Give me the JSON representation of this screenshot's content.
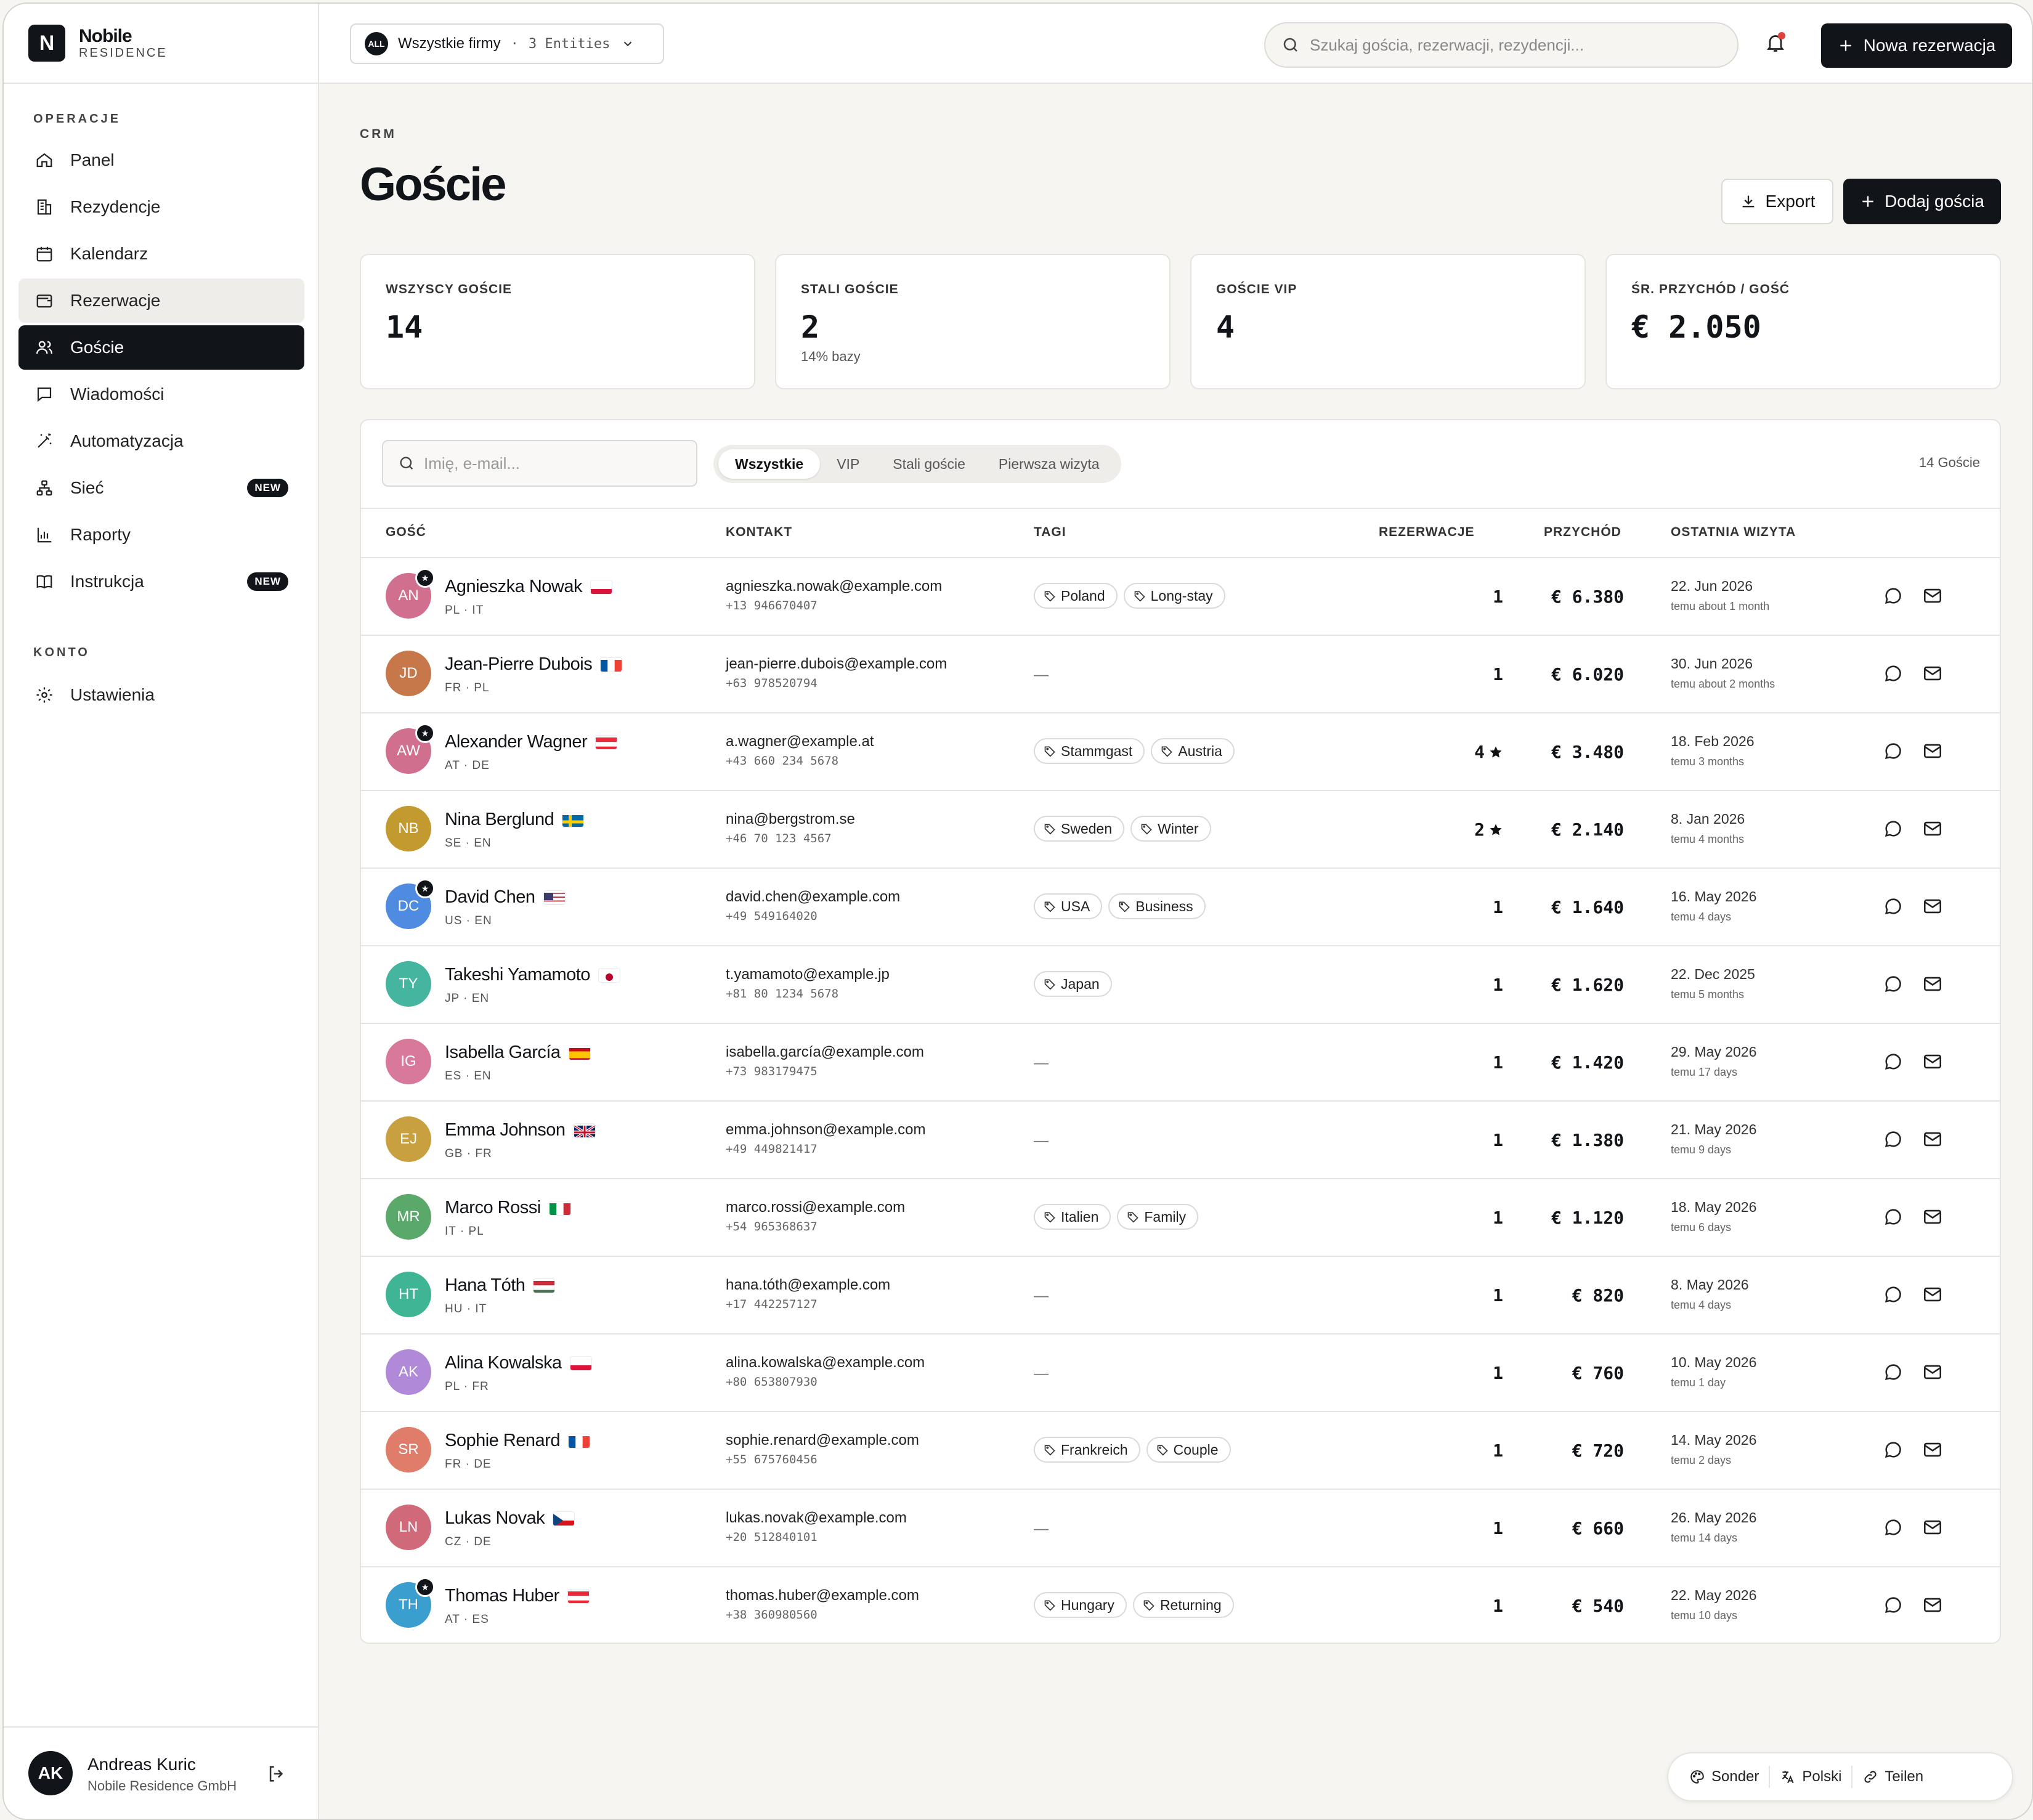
{
  "brand": {
    "logo_letter": "N",
    "name": "Nobile",
    "sub": "RESIDENCE"
  },
  "sidebar": {
    "section_ops": "OPERACJE",
    "items": [
      {
        "label": "Panel",
        "icon": "home-icon"
      },
      {
        "label": "Rezydencje",
        "icon": "building-icon"
      },
      {
        "label": "Kalendarz",
        "icon": "calendar-icon"
      },
      {
        "label": "Rezerwacje",
        "icon": "wallet-icon"
      },
      {
        "label": "Goście",
        "icon": "users-icon"
      },
      {
        "label": "Wiadomości",
        "icon": "message-icon"
      },
      {
        "label": "Automatyzacja",
        "icon": "wand-icon"
      },
      {
        "label": "Sieć",
        "icon": "network-icon",
        "badge": "NEW"
      },
      {
        "label": "Raporty",
        "icon": "chart-icon"
      },
      {
        "label": "Instrukcja",
        "icon": "book-icon",
        "badge": "NEW"
      }
    ],
    "section_account": "KONTO",
    "settings_label": "Ustawienia",
    "user": {
      "initials": "AK",
      "name": "Andreas Kuric",
      "org": "Nobile Residence GmbH"
    }
  },
  "topbar": {
    "entity_badge": "ALL",
    "entity_label": "Wszystkie firmy",
    "entity_sep": "·",
    "entity_count": "3 Entities",
    "search_placeholder": "Szukaj gościa, rezerwacji, rezydencji...",
    "new_booking": "Nowa rezerwacja"
  },
  "page": {
    "crumb": "CRM",
    "title": "Goście",
    "export": "Export",
    "add_guest": "Dodaj gościa"
  },
  "stats": [
    {
      "label": "WSZYSCY GOŚCIE",
      "value": "14",
      "sub": ""
    },
    {
      "label": "STALI GOŚCIE",
      "value": "2",
      "sub": "14% bazy"
    },
    {
      "label": "GOŚCIE VIP",
      "value": "4",
      "sub": ""
    },
    {
      "label": "ŚR. PRZYCHÓD / GOŚĆ",
      "value": "€ 2.050",
      "sub": ""
    }
  ],
  "filters": {
    "search_placeholder": "Imię, e-mail...",
    "segments": [
      "Wszystkie",
      "VIP",
      "Stali goście",
      "Pierwsza wizyta"
    ],
    "active_segment": "Wszystkie",
    "count": "14 Goście"
  },
  "table": {
    "headers": [
      "GOŚĆ",
      "KONTAKT",
      "TAGI",
      "REZERWACJE",
      "PRZYCHÓD",
      "OSTATNIA WIZYTA"
    ],
    "rows": [
      {
        "initials": "AN",
        "color": "#d0708e",
        "vip": true,
        "name": "Agnieszka Nowak",
        "flag": "pl",
        "langs": "PL · IT",
        "email": "agnieszka.nowak@example.com",
        "phone": "+13 946670407",
        "tags": [
          "Poland",
          "Long-stay"
        ],
        "res": "1",
        "star": false,
        "rev": "€ 6.380",
        "date": "22. Jun 2026",
        "rel": "temu about 1 month"
      },
      {
        "initials": "JD",
        "color": "#c7784a",
        "vip": false,
        "name": "Jean-Pierre Dubois",
        "flag": "fr",
        "langs": "FR · PL",
        "email": "jean-pierre.dubois@example.com",
        "phone": "+63 978520794",
        "tags": [],
        "res": "1",
        "star": false,
        "rev": "€ 6.020",
        "date": "30. Jun 2026",
        "rel": "temu about 2 months"
      },
      {
        "initials": "AW",
        "color": "#d0708e",
        "vip": true,
        "name": "Alexander Wagner",
        "flag": "at",
        "langs": "AT · DE",
        "email": "a.wagner@example.at",
        "phone": "+43 660 234 5678",
        "tags": [
          "Stammgast",
          "Austria"
        ],
        "res": "4",
        "star": true,
        "rev": "€ 3.480",
        "date": "18. Feb 2026",
        "rel": "temu 3 months"
      },
      {
        "initials": "NB",
        "color": "#c29a2f",
        "vip": false,
        "name": "Nina Berglund",
        "flag": "se",
        "langs": "SE · EN",
        "email": "nina@bergstrom.se",
        "phone": "+46 70 123 4567",
        "tags": [
          "Sweden",
          "Winter"
        ],
        "res": "2",
        "star": true,
        "rev": "€ 2.140",
        "date": "8. Jan 2026",
        "rel": "temu 4 months"
      },
      {
        "initials": "DC",
        "color": "#4f8be0",
        "vip": true,
        "name": "David Chen",
        "flag": "us",
        "langs": "US · EN",
        "email": "david.chen@example.com",
        "phone": "+49 549164020",
        "tags": [
          "USA",
          "Business"
        ],
        "res": "1",
        "star": false,
        "rev": "€ 1.640",
        "date": "16. May 2026",
        "rel": "temu 4 days"
      },
      {
        "initials": "TY",
        "color": "#45b5a0",
        "vip": false,
        "name": "Takeshi Yamamoto",
        "flag": "jp",
        "langs": "JP · EN",
        "email": "t.yamamoto@example.jp",
        "phone": "+81 80 1234 5678",
        "tags": [
          "Japan"
        ],
        "res": "1",
        "star": false,
        "rev": "€ 1.620",
        "date": "22. Dec 2025",
        "rel": "temu 5 months"
      },
      {
        "initials": "IG",
        "color": "#d8789a",
        "vip": false,
        "name": "Isabella García",
        "flag": "es",
        "langs": "ES · EN",
        "email": "isabella.garcía@example.com",
        "phone": "+73 983179475",
        "tags": [],
        "res": "1",
        "star": false,
        "rev": "€ 1.420",
        "date": "29. May 2026",
        "rel": "temu 17 days"
      },
      {
        "initials": "EJ",
        "color": "#c8a040",
        "vip": false,
        "name": "Emma Johnson",
        "flag": "gb",
        "langs": "GB · FR",
        "email": "emma.johnson@example.com",
        "phone": "+49 449821417",
        "tags": [],
        "res": "1",
        "star": false,
        "rev": "€ 1.380",
        "date": "21. May 2026",
        "rel": "temu 9 days"
      },
      {
        "initials": "MR",
        "color": "#5aa86a",
        "vip": false,
        "name": "Marco Rossi",
        "flag": "it",
        "langs": "IT · PL",
        "email": "marco.rossi@example.com",
        "phone": "+54 965368637",
        "tags": [
          "Italien",
          "Family"
        ],
        "res": "1",
        "star": false,
        "rev": "€ 1.120",
        "date": "18. May 2026",
        "rel": "temu 6 days"
      },
      {
        "initials": "HT",
        "color": "#3fb596",
        "vip": false,
        "name": "Hana Tóth",
        "flag": "hu",
        "langs": "HU · IT",
        "email": "hana.tóth@example.com",
        "phone": "+17 442257127",
        "tags": [],
        "res": "1",
        "star": false,
        "rev": "€ 820",
        "date": "8. May 2026",
        "rel": "temu 4 days"
      },
      {
        "initials": "AK",
        "color": "#b08ad8",
        "vip": false,
        "name": "Alina Kowalska",
        "flag": "pl",
        "langs": "PL · FR",
        "email": "alina.kowalska@example.com",
        "phone": "+80 653807930",
        "tags": [],
        "res": "1",
        "star": false,
        "rev": "€ 760",
        "date": "10. May 2026",
        "rel": "temu 1 day"
      },
      {
        "initials": "SR",
        "color": "#e07d6a",
        "vip": false,
        "name": "Sophie Renard",
        "flag": "fr",
        "langs": "FR · DE",
        "email": "sophie.renard@example.com",
        "phone": "+55 675760456",
        "tags": [
          "Frankreich",
          "Couple"
        ],
        "res": "1",
        "star": false,
        "rev": "€ 720",
        "date": "14. May 2026",
        "rel": "temu 2 days"
      },
      {
        "initials": "LN",
        "color": "#d06a7a",
        "vip": false,
        "name": "Lukas Novak",
        "flag": "cz",
        "langs": "CZ · DE",
        "email": "lukas.novak@example.com",
        "phone": "+20 512840101",
        "tags": [],
        "res": "1",
        "star": false,
        "rev": "€ 660",
        "date": "26. May 2026",
        "rel": "temu 14 days"
      },
      {
        "initials": "TH",
        "color": "#3a9ecf",
        "vip": true,
        "name": "Thomas Huber",
        "flag": "at",
        "langs": "AT · ES",
        "email": "thomas.huber@example.com",
        "phone": "+38 360980560",
        "tags": [
          "Hungary",
          "Returning"
        ],
        "res": "1",
        "star": false,
        "rev": "€ 540",
        "date": "22. May 2026",
        "rel": "temu 10 days"
      }
    ]
  },
  "floatbar": {
    "items": [
      {
        "label": "Sonder",
        "icon": "palette-icon"
      },
      {
        "label": "Polski",
        "icon": "translate-icon"
      },
      {
        "label": "Teilen",
        "icon": "link-icon"
      }
    ]
  },
  "colors": {
    "primary": "#111418",
    "bg": "#f6f5f2",
    "border": "#e6e4e0",
    "notify": "#e0413a"
  }
}
